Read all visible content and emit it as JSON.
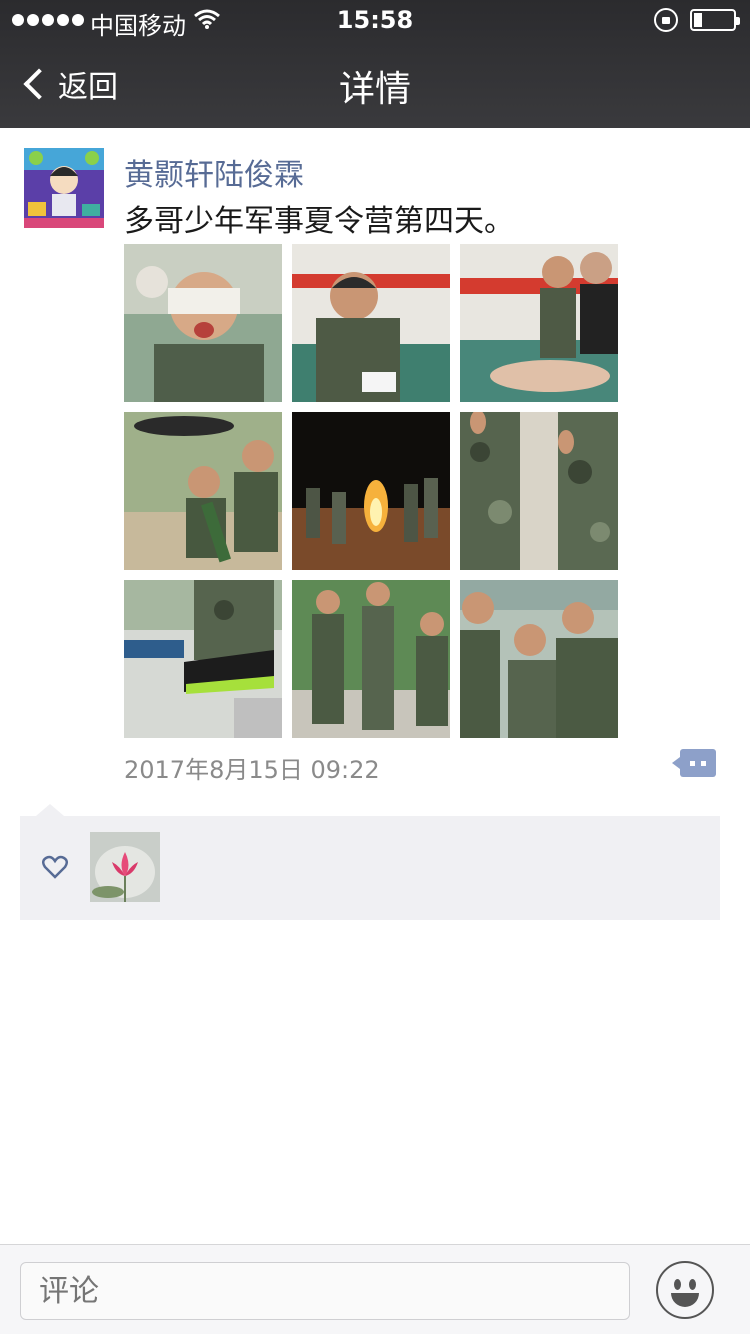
{
  "status_bar": {
    "carrier": "中国移动",
    "time": "15:58"
  },
  "nav": {
    "back_label": "返回",
    "title": "详情"
  },
  "post": {
    "author": "黄颢轩陆俊霖",
    "text": "多哥少年军事夏令营第四天。",
    "timestamp": "2017年8月15日 09:22",
    "photos": [
      {
        "icon": "photo-bandaged-boy"
      },
      {
        "icon": "photo-boy-with-paper"
      },
      {
        "icon": "photo-cpr-training"
      },
      {
        "icon": "photo-mortar-drill"
      },
      {
        "icon": "photo-campfire-night"
      },
      {
        "icon": "photo-camo-pants"
      },
      {
        "icon": "photo-sneaker"
      },
      {
        "icon": "photo-boys-standing"
      },
      {
        "icon": "photo-boys-group"
      }
    ]
  },
  "likes": {
    "icon": "heart-icon",
    "likers": [
      {
        "avatar": "lotus-avatar"
      }
    ]
  },
  "comment_bar": {
    "placeholder": "评论"
  },
  "colors": {
    "nav_bg": "#333336",
    "link_blue": "#576b95",
    "likes_bg": "#f0f0f3",
    "action_blue": "#8da0c9"
  }
}
